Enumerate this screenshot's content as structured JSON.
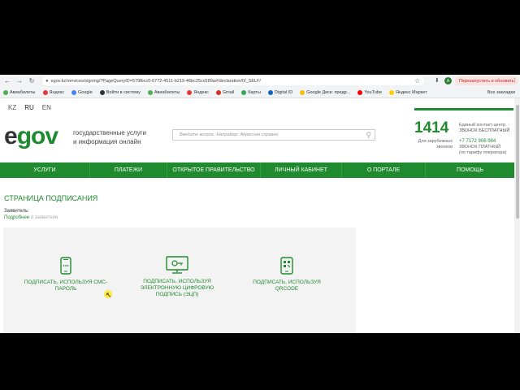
{
  "browser": {
    "url": "egov.kz/services/signing/?PageQueryID=579fbcc0-6772-4511-b219-46bc25cd189a#/declaration/0/_SELF/",
    "restart_label": "Перезапустить и обновить",
    "profile_letter": "A",
    "bookmarks": [
      {
        "label": "Авиабилеты",
        "color": "#4caf50"
      },
      {
        "label": "Яндекс",
        "color": "#e53935"
      },
      {
        "label": "Google",
        "color": "#4285f4"
      },
      {
        "label": "Войти в систему",
        "color": "#333333"
      },
      {
        "label": "Авиабилеты",
        "color": "#4caf50"
      },
      {
        "label": "Яндекс",
        "color": "#e53935"
      },
      {
        "label": "Gmail",
        "color": "#d93025"
      },
      {
        "label": "Карты",
        "color": "#34a853"
      },
      {
        "label": "Digital ID",
        "color": "#1565c0"
      },
      {
        "label": "Google Диск: предр...",
        "color": "#fbbc04"
      },
      {
        "label": "YouTube",
        "color": "#ff0000"
      },
      {
        "label": "Яндекс Маркет",
        "color": "#ffcc00"
      }
    ],
    "all_bookmarks": "Все закладки"
  },
  "header": {
    "langs": [
      "KZ",
      "RU",
      "EN"
    ],
    "active_lang": "RU",
    "logo_e": "e",
    "logo_gov": "gov",
    "tagline_1": "государственные услуги",
    "tagline_2": "и информация онлайн",
    "search_placeholder": "Введите вопрос. Например: Адресная справка",
    "phone": "1414",
    "phone_note_1": "Для зарубежных",
    "phone_note_2": "звонков",
    "contact_1": "Единый контакт-центр",
    "contact_2": "ЗВОНОК БЕСПЛАТНЫЙ",
    "contact_num": "+7 7172 906 984",
    "contact_3": "ЗВОНОК ПЛАТНЫЙ",
    "contact_4": "(по тарифу оператора)"
  },
  "menu": [
    "УСЛУГИ",
    "ПЛАТЕЖИ",
    "ОТКРЫТОЕ ПРАВИТЕЛЬСТВО",
    "ЛИЧНЫЙ КАБИНЕТ",
    "О ПОРТАЛЕ",
    "ПОМОЩЬ"
  ],
  "main": {
    "title": "СТРАНИЦА ПОДПИСАНИЯ",
    "applicant_label": "Заявитель:",
    "more_label": "Подробнее",
    "more_faded": "о заявителе",
    "options": {
      "sms_1": "ПОДПИСАТЬ, ИСПОЛЬЗУЯ СМС-",
      "sms_2": "ПАРОЛЬ",
      "ecp_1": "ПОДПИСАТЬ, ИСПОЛЬЗУЯ",
      "ecp_2": "ЭЛЕКТРОННУЮ ЦИФРОВУЮ",
      "ecp_3": "ПОДПИСЬ (ЭЦП)",
      "qr_1": "ПОДПИСАТЬ, ИСПОЛЬЗУЯ",
      "qr_2": "QRCODE"
    }
  },
  "colors": {
    "brand": "#1f8a2e"
  }
}
